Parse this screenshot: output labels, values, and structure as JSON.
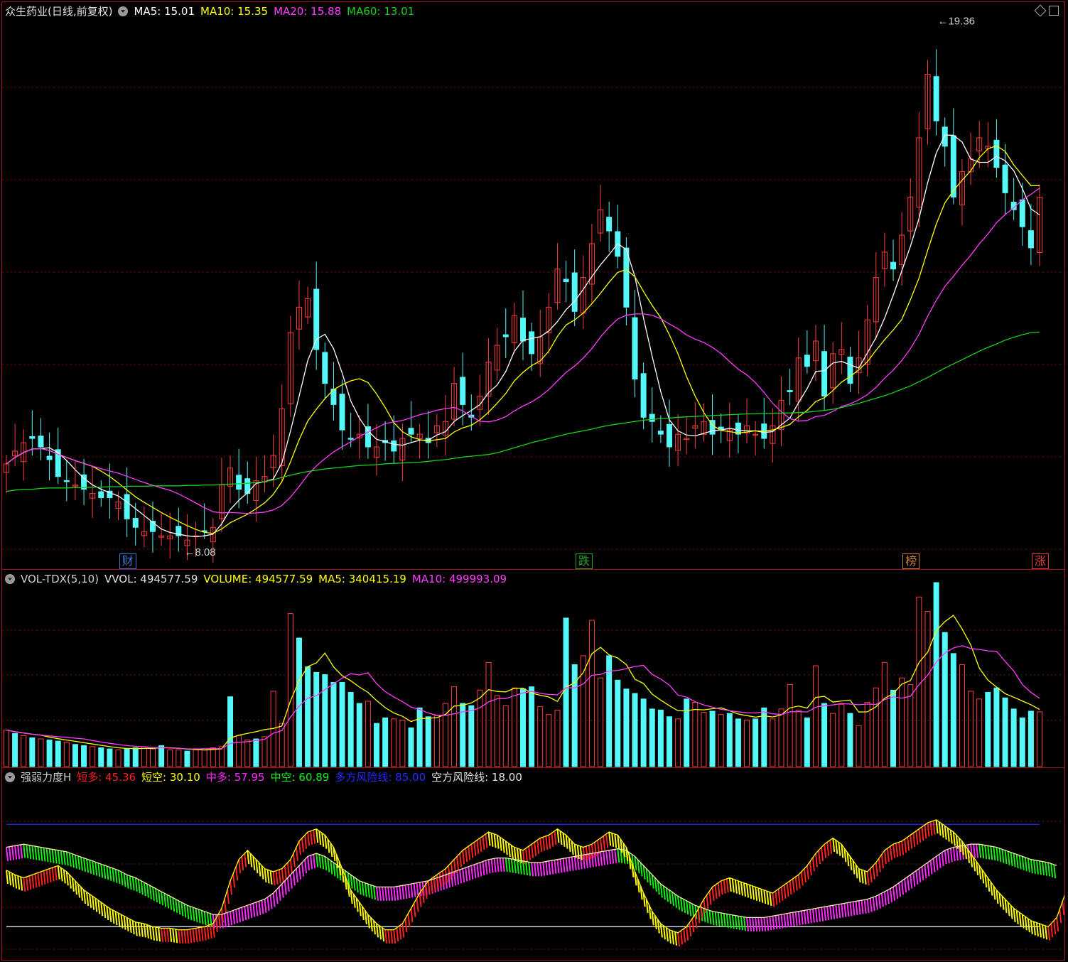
{
  "main": {
    "stock_title": "众生药业(日线,前复权)",
    "ma5": "MA5: 15.01",
    "ma10": "MA10: 15.35",
    "ma20": "MA20: 15.88",
    "ma60": "MA60: 13.01",
    "high_label": "19.36",
    "low_label": "8.08",
    "markers": [
      {
        "text": "财",
        "color": "#3a7bd5"
      },
      {
        "text": "跌",
        "color": "#2aa52a"
      },
      {
        "text": "榜",
        "color": "#c87f3a"
      },
      {
        "text": "涨",
        "color": "#e23c3c"
      }
    ],
    "price_range": [
      7.8,
      20.3
    ],
    "closes": [
      9.9,
      10.2,
      10.4,
      10.5,
      10.3,
      10.0,
      9.6,
      9.5,
      9.4,
      9.3,
      9.2,
      9.1,
      9.1,
      9.0,
      8.6,
      8.4,
      8.3,
      8.3,
      8.2,
      8.2,
      8.2,
      8.1,
      8.2,
      8.3,
      8.4,
      9.4,
      9.8,
      9.3,
      9.2,
      9.5,
      9.6,
      10.1,
      11.2,
      13.0,
      13.6,
      13.8,
      12.6,
      11.8,
      11.3,
      10.7,
      10.5,
      10.6,
      10.3,
      10.3,
      10.4,
      10.2,
      10.5,
      10.6,
      10.6,
      10.4,
      10.8,
      10.9,
      11.8,
      11.3,
      11.0,
      11.5,
      12.3,
      12.7,
      12.9,
      13.4,
      12.8,
      12.5,
      12.9,
      13.6,
      14.5,
      14.2,
      13.5,
      14.3,
      15.1,
      15.9,
      15.4,
      14.8,
      13.6,
      11.9,
      11.0,
      10.9,
      10.6,
      10.3,
      10.6,
      10.5,
      10.8,
      10.9,
      10.6,
      10.7,
      10.7,
      10.6,
      10.8,
      10.6,
      10.5,
      10.8,
      11.4,
      11.6,
      12.4,
      12.2,
      12.8,
      11.5,
      12.5,
      12.6,
      11.8,
      12.4,
      13.3,
      14.3,
      14.9,
      14.5,
      15.3,
      16.2,
      17.6,
      19.1,
      18.0,
      17.4,
      16.2,
      16.8,
      17.1,
      17.6,
      17.4,
      16.9,
      16.3,
      15.9,
      15.5,
      15.0,
      16.2
    ],
    "ma60_values": [
      9.25,
      9.28,
      9.3,
      9.3,
      9.32,
      9.33,
      9.33,
      9.33,
      9.34,
      9.34,
      9.35,
      9.35,
      9.36,
      9.36,
      9.37,
      9.37,
      9.37,
      9.38,
      9.38,
      9.38,
      9.38,
      9.39,
      9.39,
      9.4,
      9.4,
      9.41,
      9.42,
      9.43,
      9.44,
      9.46,
      9.48,
      9.52,
      9.58,
      9.63,
      9.68,
      9.72,
      9.75,
      9.78,
      9.8,
      9.82,
      9.84,
      9.86,
      9.87,
      9.88,
      9.9,
      9.91,
      9.92,
      9.93,
      9.94,
      9.96,
      9.98,
      10.0,
      10.03,
      10.06,
      10.08,
      10.1,
      10.12,
      10.16,
      10.22,
      10.28,
      10.34,
      10.4,
      10.45,
      10.5,
      10.55,
      10.6,
      10.64,
      10.68,
      10.72,
      10.77,
      10.81,
      10.84,
      10.87,
      10.9,
      10.93,
      10.95,
      10.97,
      10.98,
      11.0,
      11.01,
      11.02,
      11.03,
      11.04,
      11.05,
      11.06,
      11.07,
      11.08,
      11.08,
      11.09,
      11.09,
      11.1,
      11.1,
      11.11,
      11.12,
      11.14,
      11.16,
      11.19,
      11.23,
      11.28,
      11.33,
      11.39,
      11.45,
      11.51,
      11.58,
      11.66,
      11.74,
      11.84,
      11.94,
      12.05,
      12.16,
      12.26,
      12.36,
      12.46,
      12.56,
      12.65,
      12.73,
      12.82,
      12.89,
      12.95,
      13.0,
      13.01
    ]
  },
  "volume": {
    "title": "VOL-TDX(5,10)",
    "vvol": "VVOL: 494577.59",
    "volume": "VOLUME: 494577.59",
    "ma5": "MA5: 340415.19",
    "ma10": "MA10: 499993.09",
    "range_max": 1400000,
    "values": [
      330000,
      300000,
      280000,
      260000,
      250000,
      240000,
      230000,
      220000,
      200000,
      190000,
      180000,
      170000,
      160000,
      150000,
      160000,
      170000,
      180000,
      160000,
      190000,
      150000,
      150000,
      140000,
      150000,
      160000,
      170000,
      180000,
      630000,
      280000,
      240000,
      250000,
      270000,
      680000,
      390000,
      1380000,
      1160000,
      900000,
      850000,
      830000,
      760000,
      760000,
      670000,
      570000,
      590000,
      390000,
      440000,
      430000,
      420000,
      350000,
      530000,
      450000,
      460000,
      570000,
      720000,
      570000,
      550000,
      690000,
      940000,
      640000,
      550000,
      710000,
      700000,
      720000,
      540000,
      470000,
      510000,
      1340000,
      920000,
      1000000,
      1320000,
      800000,
      1000000,
      780000,
      700000,
      660000,
      610000,
      520000,
      510000,
      450000,
      430000,
      610000,
      580000,
      490000,
      500000,
      470000,
      480000,
      430000,
      420000,
      430000,
      530000,
      430000,
      520000,
      740000,
      510000,
      440000,
      910000,
      570000,
      480000,
      560000,
      480000,
      370000,
      580000,
      710000,
      940000,
      690000,
      800000,
      740000,
      1530000,
      1400000,
      1660000,
      1210000,
      1020000,
      920000,
      680000,
      610000,
      670000,
      710000,
      620000,
      520000,
      440000,
      500000,
      495000
    ],
    "rising": [
      1,
      0,
      1,
      0,
      1,
      0,
      0,
      1,
      0,
      0,
      1,
      0,
      0,
      1,
      0,
      0,
      1,
      1,
      0,
      1,
      1,
      0,
      1,
      1,
      1,
      1,
      0,
      1,
      1,
      0,
      1,
      1,
      1,
      1,
      0,
      0,
      0,
      0,
      0,
      0,
      0,
      0,
      1,
      0,
      0,
      1,
      1,
      0,
      0,
      0,
      1,
      1,
      1,
      0,
      0,
      1,
      1,
      1,
      1,
      1,
      0,
      0,
      1,
      1,
      1,
      0,
      0,
      1,
      1,
      1,
      0,
      0,
      0,
      0,
      0,
      0,
      0,
      0,
      1,
      0,
      1,
      1,
      0,
      1,
      0,
      0,
      1,
      0,
      0,
      1,
      1,
      1,
      1,
      0,
      1,
      0,
      1,
      1,
      0,
      1,
      1,
      1,
      1,
      0,
      1,
      1,
      1,
      1,
      0,
      0,
      0,
      1,
      1,
      1,
      0,
      0,
      0,
      0,
      0,
      0,
      1
    ]
  },
  "indicator": {
    "title": "强弱力度H",
    "short_long": "短多: 45.36",
    "short_short": "短空: 30.10",
    "mid_long": "中多: 57.95",
    "mid_short": "中空: 60.89",
    "long_risk": "多方风险线: 85.00",
    "short_risk": "空方风险线: 18.00",
    "short_values": [
      55,
      52,
      50,
      52,
      54,
      56,
      58,
      54,
      48,
      42,
      38,
      34,
      30,
      27,
      24,
      21,
      20,
      18,
      17,
      17,
      16,
      16,
      17,
      18,
      20,
      30,
      48,
      62,
      68,
      62,
      56,
      54,
      56,
      62,
      74,
      80,
      82,
      78,
      70,
      56,
      42,
      34,
      26,
      20,
      16,
      16,
      20,
      30,
      40,
      48,
      52,
      56,
      62,
      68,
      72,
      76,
      80,
      78,
      74,
      70,
      68,
      72,
      76,
      78,
      82,
      78,
      72,
      70,
      72,
      76,
      80,
      78,
      70,
      54,
      40,
      28,
      20,
      16,
      14,
      18,
      26,
      36,
      44,
      48,
      50,
      48,
      46,
      44,
      42,
      40,
      44,
      48,
      52,
      58,
      66,
      72,
      76,
      72,
      64,
      56,
      54,
      60,
      68,
      72,
      74,
      78,
      82,
      86,
      88,
      84,
      80,
      74,
      66,
      58,
      50,
      42,
      36,
      30,
      26,
      22,
      20,
      18,
      24,
      40
    ],
    "mid_values": [
      70,
      71,
      72,
      71,
      70,
      69,
      68,
      67,
      65,
      63,
      61,
      59,
      57,
      55,
      52,
      50,
      47,
      44,
      41,
      38,
      35,
      32,
      30,
      28,
      26,
      26,
      28,
      30,
      32,
      34,
      36,
      40,
      46,
      52,
      58,
      64,
      66,
      64,
      60,
      56,
      52,
      48,
      46,
      44,
      44,
      44,
      45,
      46,
      47,
      48,
      50,
      52,
      54,
      56,
      58,
      60,
      62,
      63,
      63,
      62,
      61,
      60,
      60,
      61,
      62,
      63,
      64,
      65,
      66,
      67,
      68,
      69,
      68,
      64,
      58,
      52,
      46,
      42,
      38,
      35,
      32,
      30,
      28,
      27,
      26,
      25,
      24,
      24,
      24,
      25,
      26,
      27,
      28,
      29,
      30,
      31,
      32,
      33,
      34,
      35,
      36,
      38,
      41,
      44,
      48,
      52,
      56,
      60,
      64,
      68,
      70,
      71,
      72,
      72,
      71,
      70,
      68,
      66,
      64,
      62,
      61,
      60,
      58
    ]
  },
  "colors": {
    "ma5": "#ffffff",
    "ma10": "#ffff00",
    "ma20": "#ff3cff",
    "ma60": "#19d219",
    "up": "#ff3c3c",
    "down": "#54f8f8",
    "border": "#a0141e",
    "grid": "#7a1010",
    "short_long": "#ff2020",
    "short_short": "#ffff00",
    "mid_long": "#ff28ff",
    "mid_short": "#14f014",
    "long_risk": "#2828ff",
    "short_risk": "#e0e0e0"
  }
}
